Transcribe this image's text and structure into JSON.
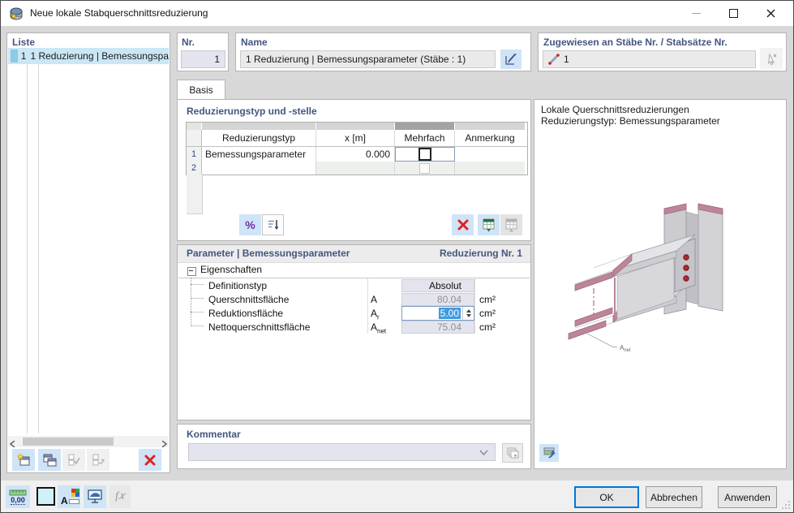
{
  "window": {
    "title": "Neue lokale Stabquerschnittsreduzierung"
  },
  "liste": {
    "label": "Liste",
    "selected_item": {
      "nr": "1",
      "text": "1 Reduzierung | Bemessungspa"
    }
  },
  "header": {
    "nr_label": "Nr.",
    "nr_value": "1",
    "name_label": "Name",
    "name_value": "1 Reduzierung | Bemessungsparameter (Stäbe : 1)",
    "assigned_label": "Zugewiesen an Stäbe Nr. / Stabsätze Nr.",
    "assigned_value": "1"
  },
  "tab": {
    "label": "Basis"
  },
  "reduction": {
    "title": "Reduzierungstyp und -stelle",
    "columns": [
      "Reduzierungstyp",
      "x [m]",
      "Mehrfach",
      "Anmerkung"
    ],
    "rows": [
      {
        "nr": "1",
        "type": "Bemessungsparameter",
        "x": "0.000",
        "multiple": false,
        "note": ""
      },
      {
        "nr": "2",
        "type": "",
        "x": "",
        "note": ""
      }
    ],
    "percent_label": "%"
  },
  "params": {
    "title": "Parameter | Bemessungsparameter",
    "badge": "Reduzierung Nr. 1",
    "group": "Eigenschaften",
    "rows": [
      {
        "label": "Definitionstyp",
        "symbol": "",
        "symbol_sub": "",
        "value": "Absolut",
        "unit": ""
      },
      {
        "label": "Querschnittsfläche",
        "symbol": "A",
        "symbol_sub": "",
        "value": "80.04",
        "unit": "cm²"
      },
      {
        "label": "Reduktionsfläche",
        "symbol": "A",
        "symbol_sub": "r",
        "value": "5.00",
        "unit": "cm²"
      },
      {
        "label": "Nettoquerschnittsfläche",
        "symbol": "A",
        "symbol_sub": "net",
        "value": "75.04",
        "unit": "cm²"
      }
    ]
  },
  "graphic": {
    "line1": "Lokale Querschnittsreduzierungen",
    "line2": "Reduzierungstyp: Bemessungsparameter",
    "annotation": "A",
    "annotation_sub": "net"
  },
  "kommentar": {
    "label": "Kommentar",
    "value": ""
  },
  "footer": {
    "ok": "OK",
    "cancel": "Abbrechen",
    "apply": "Anwenden"
  },
  "statusbar": {
    "units_value": "0,00"
  },
  "colors": {
    "accent_blue": "#cfe4f7",
    "header_blue": "#44567E",
    "selection_blue": "#3f9be0",
    "delete_red": "#e02222",
    "ok_border": "#0078d7",
    "section_pink": "#bd8599"
  }
}
